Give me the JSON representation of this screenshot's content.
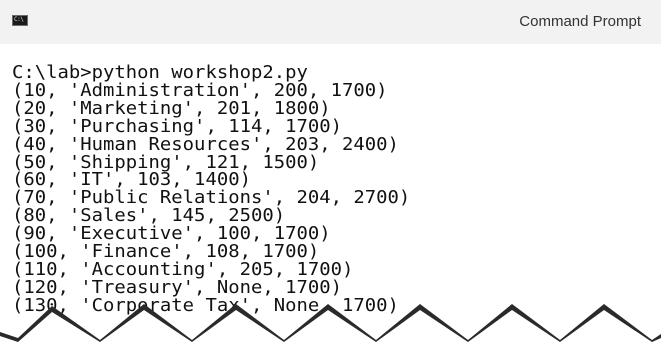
{
  "window": {
    "title": "Command Prompt",
    "icon": "console-app-icon",
    "icon_glyph": "C:\\",
    "colors": {
      "titlebar": "#f2f2f2",
      "background": "#ffffff",
      "text": "#111111"
    }
  },
  "console": {
    "lines": [
      "C:\\lab>python workshop2.py",
      "(10, 'Administration', 200, 1700)",
      "(20, 'Marketing', 201, 1800)",
      "(30, 'Purchasing', 114, 1700)",
      "(40, 'Human Resources', 203, 2400)",
      "(50, 'Shipping', 121, 1500)",
      "(60, 'IT', 103, 1400)",
      "(70, 'Public Relations', 204, 2700)",
      "(80, 'Sales', 145, 2500)",
      "(90, 'Executive', 100, 1700)",
      "(100, 'Finance', 108, 1700)",
      "(110, 'Accounting', 205, 1700)",
      "(120, 'Treasury', None, 1700)",
      "(130, 'Corporate Tax', None, 1700)"
    ]
  }
}
